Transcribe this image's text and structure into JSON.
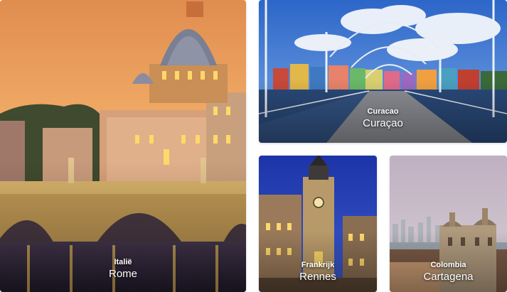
{
  "cards": [
    {
      "country": "Italië",
      "city": "Rome"
    },
    {
      "country": "Curacao",
      "city": "Curaçao"
    },
    {
      "country": "Frankrijk",
      "city": "Rennes"
    },
    {
      "country": "Colombia",
      "city": "Cartagena"
    }
  ],
  "colors": {
    "rome_sky_top": "#d98a4c",
    "rome_sky_bottom": "#f4b26a",
    "curacao_sky": "#2f6fcf",
    "rennes_sky": "#2a45b8",
    "cartagena_sky": "#c9b8c8"
  }
}
